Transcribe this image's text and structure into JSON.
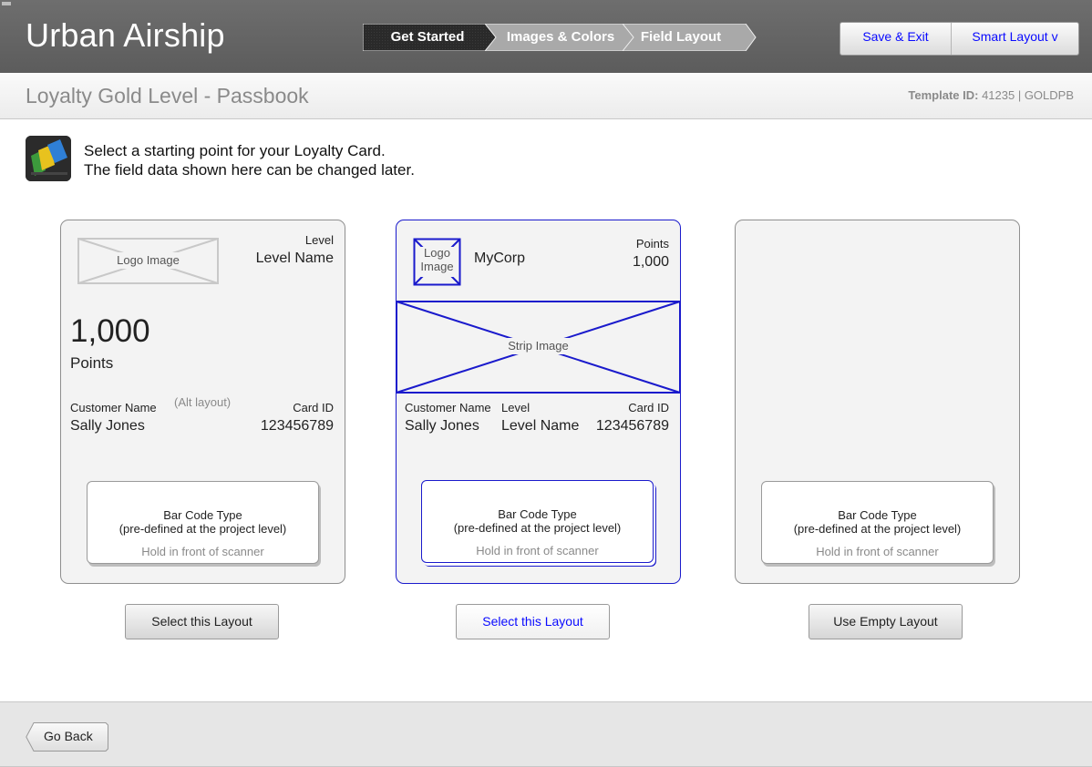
{
  "app": {
    "title": "Urban Airship"
  },
  "steps": [
    {
      "label": "Get Started",
      "state": "active"
    },
    {
      "label": "Images & Colors",
      "state": "inactive"
    },
    {
      "label": "Field Layout",
      "state": "inactive"
    }
  ],
  "header": {
    "save_exit": "Save & Exit",
    "smart_layout": "Smart Layout ᴠ"
  },
  "subheader": {
    "title": "Loyalty Gold Level - Passbook",
    "template_id_label": "Template ID:",
    "template_id_value": " 41235 | GOLDPB"
  },
  "intro": {
    "icon": "wallet-passes-icon",
    "line1": "Select a starting point for your Loyalty Card.",
    "line2": "The field data shown here can be changed later."
  },
  "cards": [
    {
      "logo_caption": "Logo Image",
      "level_label": "Level",
      "level_value": "Level Name",
      "points_value": "1,000",
      "points_label": "Points",
      "customer_label": "Customer Name",
      "alt_note": "(Alt layout)",
      "card_id_label": "Card ID",
      "customer_value": "Sally Jones",
      "card_id_value": "123456789",
      "barcode_type": "Bar Code Type",
      "barcode_note": "(pre-defined at the project level)",
      "barcode_hint": "Hold in front of scanner",
      "button": "Select this Layout"
    },
    {
      "logo_caption_1": "Logo",
      "logo_caption_2": "Image",
      "company": "MyCorp",
      "points_label": "Points",
      "points_value": "1,000",
      "strip_caption": "Strip Image",
      "customer_label": "Customer Name",
      "level_label": "Level",
      "card_id_label": "Card ID",
      "customer_value": "Sally Jones",
      "level_value": "Level Name",
      "card_id_value": "123456789",
      "barcode_type": "Bar Code Type",
      "barcode_note": "(pre-defined at the project level)",
      "barcode_hint": "Hold in front of scanner",
      "button": "Select this Layout"
    },
    {
      "barcode_type": "Bar Code Type",
      "barcode_note": "(pre-defined at the project level)",
      "barcode_hint": "Hold in front of scanner",
      "button": "Use Empty Layout"
    }
  ],
  "footer": {
    "back": "Go Back"
  },
  "colors": {
    "header_bg": "#5c5c5c",
    "active_step": "#2a2a2a",
    "inactive_step": "#a9a9a9",
    "link_blue": "#0a0aff",
    "selected_border": "#1a1acc"
  }
}
